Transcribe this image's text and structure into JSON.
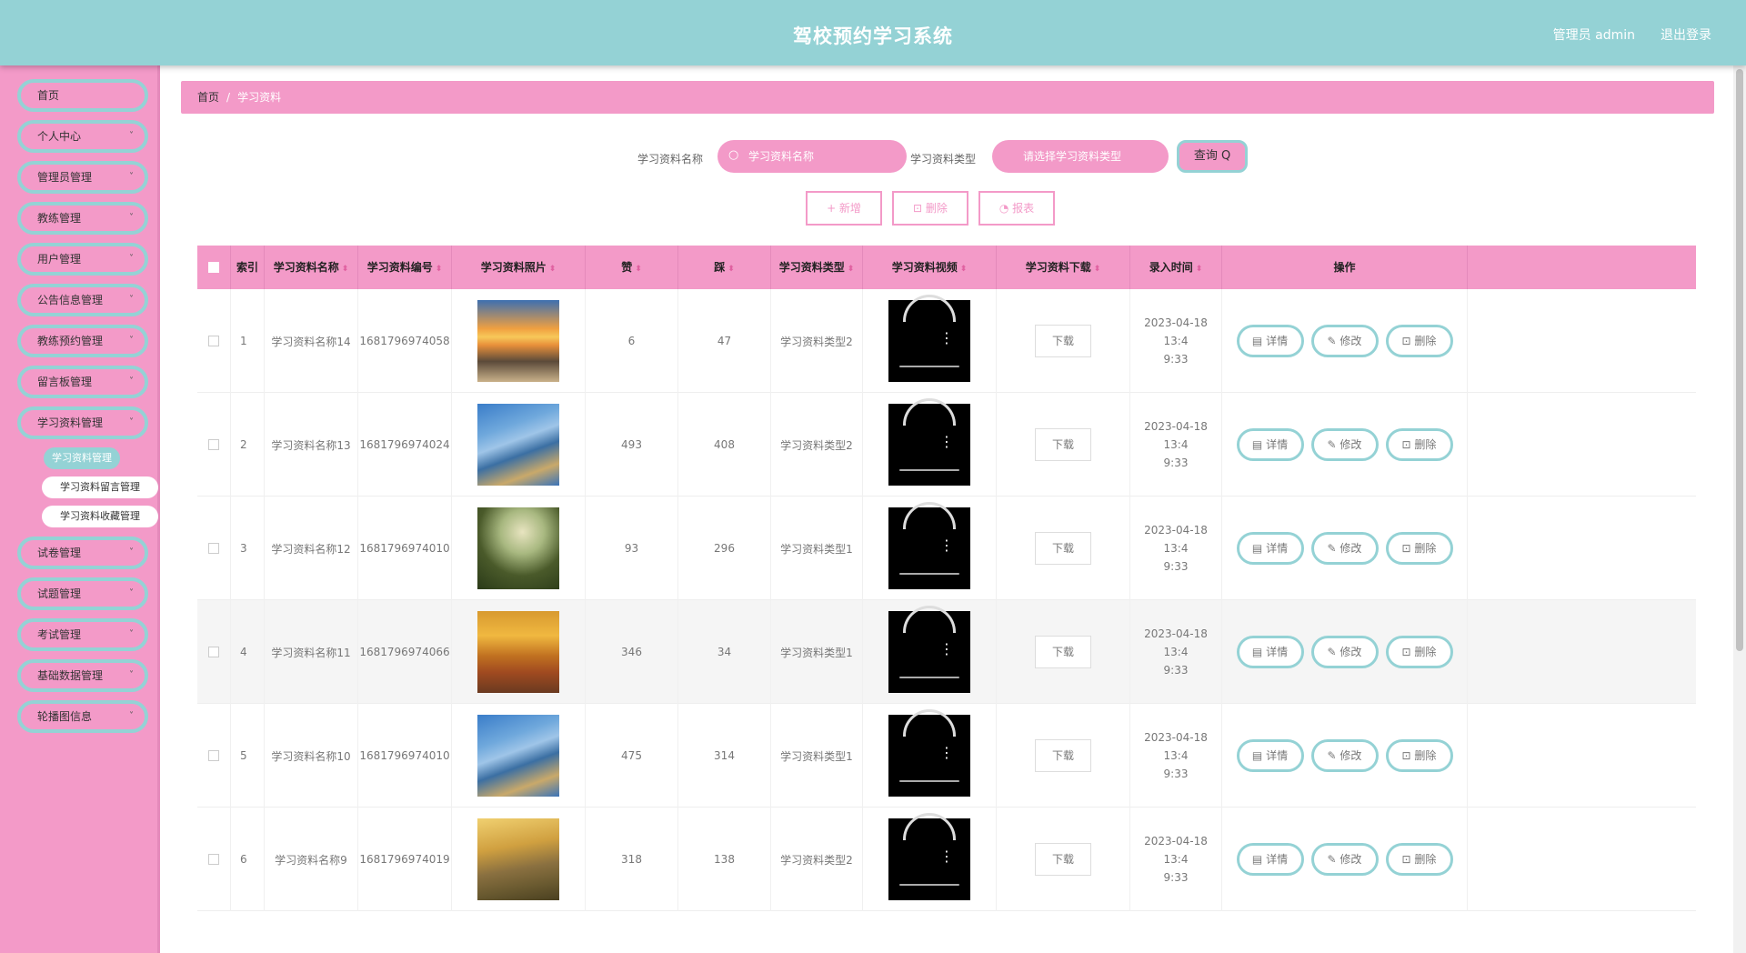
{
  "header": {
    "title": "驾校预约学习系统",
    "user": "管理员 admin",
    "logout": "退出登录"
  },
  "sidebar": {
    "items": [
      {
        "label": "首页",
        "chev": false
      },
      {
        "label": "个人中心",
        "chev": true
      },
      {
        "label": "管理员管理",
        "chev": true
      },
      {
        "label": "教练管理",
        "chev": true
      },
      {
        "label": "用户管理",
        "chev": true
      },
      {
        "label": "公告信息管理",
        "chev": true
      },
      {
        "label": "教练预约管理",
        "chev": true
      },
      {
        "label": "留言板管理",
        "chev": true
      },
      {
        "label": "学习资料管理",
        "chev": true
      }
    ],
    "sub": [
      "学习资料管理",
      "学习资料留言管理",
      "学习资料收藏管理"
    ],
    "items2": [
      {
        "label": "试卷管理",
        "chev": true
      },
      {
        "label": "试题管理",
        "chev": true
      },
      {
        "label": "考试管理",
        "chev": true
      },
      {
        "label": "基础数据管理",
        "chev": true
      },
      {
        "label": "轮播图信息",
        "chev": true
      }
    ],
    "chev_icon": "˅"
  },
  "breadcrumb": {
    "home": "首页",
    "sep": "/",
    "current": "学习资料"
  },
  "search": {
    "name_label": "学习资料名称",
    "name_placeholder": "学习资料名称",
    "type_label": "学习资料类型",
    "type_placeholder": "请选择学习资料类型",
    "query": "查询 Q"
  },
  "actions": {
    "add": "+ 新增",
    "delete": "删除",
    "report": "报表"
  },
  "table": {
    "headers": [
      "索引",
      "学习资料名称",
      "学习资料编号",
      "学习资料照片",
      "赞",
      "踩",
      "学习资料类型",
      "学习资料视频",
      "学习资料下载",
      "录入时间",
      "操作"
    ],
    "download_label": "下载",
    "op_detail": "详情",
    "op_edit": "修改",
    "op_delete": "删除",
    "rows": [
      {
        "index": "1",
        "name": "学习资料名称14",
        "code": "1681796974058",
        "zan": "6",
        "cai": "47",
        "type": "学习资料类型2",
        "time1": "2023-04-18 13:4",
        "time2": "9:33",
        "img": "sunset"
      },
      {
        "index": "2",
        "name": "学习资料名称13",
        "code": "1681796974024",
        "zan": "493",
        "cai": "408",
        "type": "学习资料类型2",
        "time1": "2023-04-18 13:4",
        "time2": "9:33",
        "img": "river"
      },
      {
        "index": "3",
        "name": "学习资料名称12",
        "code": "1681796974010",
        "zan": "93",
        "cai": "296",
        "type": "学习资料类型1",
        "time1": "2023-04-18 13:4",
        "time2": "9:33",
        "img": "forest"
      },
      {
        "index": "4",
        "name": "学习资料名称11",
        "code": "1681796974066",
        "zan": "346",
        "cai": "34",
        "type": "学习资料类型1",
        "time1": "2023-04-18 13:4",
        "time2": "9:33",
        "img": "autumn"
      },
      {
        "index": "5",
        "name": "学习资料名称10",
        "code": "1681796974010",
        "zan": "475",
        "cai": "314",
        "type": "学习资料类型1",
        "time1": "2023-04-18 13:4",
        "time2": "9:33",
        "img": "river"
      },
      {
        "index": "6",
        "name": "学习资料名称9",
        "code": "1681796974019",
        "zan": "318",
        "cai": "138",
        "type": "学习资料类型2",
        "time1": "2023-04-18 13:4",
        "time2": "9:33",
        "img": "hill"
      }
    ]
  }
}
